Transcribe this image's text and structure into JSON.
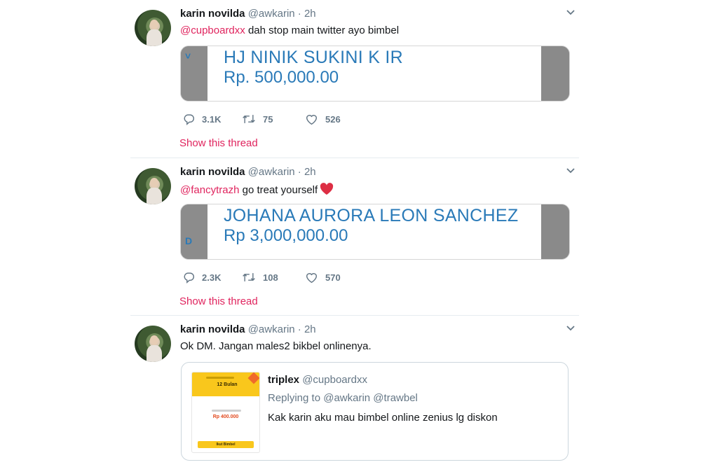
{
  "colors": {
    "accent": "#e0245e",
    "text": "#14171a",
    "muted": "#657786",
    "border": "#e6ecf0",
    "link_blue": "#2a7ab8"
  },
  "tweets": [
    {
      "author_name": "karin novilda",
      "author_handle": "@awkarin",
      "separator": "·",
      "time": "2h",
      "mention": "@cupboardxx",
      "text": " dah stop main twitter ayo bimbel",
      "media": {
        "name": "HJ NINIK SUKINI K IR",
        "amount": "Rp. 500,000.00",
        "fragment": "˅"
      },
      "actions": {
        "replies": "3.1K",
        "retweets": "75",
        "likes": "526"
      },
      "show_thread": "Show this thread"
    },
    {
      "author_name": "karin novilda",
      "author_handle": "@awkarin",
      "separator": "·",
      "time": "2h",
      "mention": "@fancytrazh",
      "text": " go treat yourself",
      "media": {
        "name": "JOHANA AURORA LEON SANCHEZ",
        "amount": "Rp 3,000,000.00",
        "fragment": "D"
      },
      "actions": {
        "replies": "2.3K",
        "retweets": "108",
        "likes": "570"
      },
      "show_thread": "Show this thread"
    },
    {
      "author_name": "karin novilda",
      "author_handle": "@awkarin",
      "separator": "·",
      "time": "2h",
      "text": "Ok DM. Jangan males2 bikbel onlinenya.",
      "quote": {
        "author_name": "triplex",
        "author_handle": "@cupboardxx",
        "reply_prefix": "Replying to",
        "reply_to": "@awkarin @trawbel",
        "text": "Kak karin aku mau bimbel online zenius lg diskon",
        "media": {
          "plan_title": "12 Bulan",
          "price": "Rp 400.000",
          "button_label": "Ikut Bimbel"
        }
      }
    }
  ]
}
